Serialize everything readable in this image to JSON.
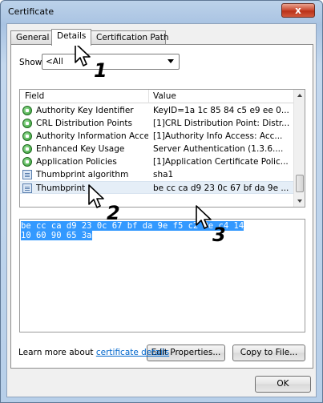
{
  "window": {
    "title": "Certificate",
    "close_label": "x"
  },
  "tabs": [
    {
      "label": "General"
    },
    {
      "label": "Details"
    },
    {
      "label": "Certification Path"
    }
  ],
  "show": {
    "label": "Show:",
    "selected_value": "<All"
  },
  "list": {
    "columns": [
      "Field",
      "Value"
    ],
    "rows": [
      {
        "field": "Authority Key Identifier",
        "value": "KeyID=1a 1c 85 84 c5 e9 ee 0...",
        "icon": "extension-icon"
      },
      {
        "field": "CRL Distribution Points",
        "value": "[1]CRL Distribution Point: Distr...",
        "icon": "extension-icon"
      },
      {
        "field": "Authority Information Access",
        "value": "[1]Authority Info Access: Acc...",
        "icon": "extension-icon"
      },
      {
        "field": "Enhanced Key Usage",
        "value": "Server Authentication (1.3.6....",
        "icon": "extension-icon"
      },
      {
        "field": "Application Policies",
        "value": "[1]Application Certificate Polic...",
        "icon": "extension-icon"
      },
      {
        "field": "Thumbprint algorithm",
        "value": "sha1",
        "icon": "property-icon"
      },
      {
        "field": "Thumbprint",
        "value": "be cc ca d9 23 0c 67 bf da 9e ...",
        "icon": "property-icon"
      }
    ]
  },
  "detail": {
    "line1": "be cc ca d9 23 0c 67 bf da 9e f5 c2 0e c4 14",
    "line2": "10 60 90 65 3a"
  },
  "buttons": {
    "edit_properties": "Edit Properties...",
    "copy_to_file": "Copy to File...",
    "ok": "OK"
  },
  "learn_more": {
    "prefix": "Learn more about ",
    "link": "certificate details"
  },
  "callouts": [
    "1",
    "2",
    "3"
  ]
}
